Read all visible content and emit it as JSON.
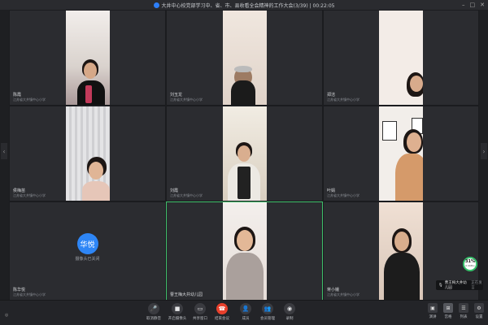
{
  "titlebar": {
    "title": "大井中心校党部学习中、省、市、县收看全会精神的工作大会(3/39) | 00:22:05"
  },
  "tiles": [
    {
      "name": "陈霞",
      "sub": "江苏省大井镇中心小学"
    },
    {
      "name": "刘玉龙",
      "sub": "江苏省大井镇中心小学"
    },
    {
      "name": "郑洁",
      "sub": "江苏省大井镇中心小学"
    },
    {
      "name": "侯梅苗",
      "sub": "江苏省大井镇中心小学"
    },
    {
      "name": "刘霞",
      "sub": "江苏省大井镇中心小学"
    },
    {
      "name": "叶娟",
      "sub": "江苏省大井镇中心小学"
    },
    {
      "name": "陈华悦",
      "sub": "江苏省大井镇中心小学",
      "avatar_text": "华悦",
      "avatar_caption": "摄像头已关闭"
    },
    {
      "name": "曹王梅大井幼儿园",
      "sub": ""
    },
    {
      "name": "蒋小娥",
      "sub": "江苏省大井镇中心小学"
    }
  ],
  "toolbar": {
    "buttons": [
      {
        "label": "取消静音",
        "icon": "mic-icon"
      },
      {
        "label": "开启摄像头",
        "icon": "camera-icon"
      },
      {
        "label": "共享窗口",
        "icon": "share-icon"
      },
      {
        "label": "结束会议",
        "icon": "end-call-icon"
      },
      {
        "label": "成员",
        "icon": "members-icon"
      },
      {
        "label": "会员管理",
        "icon": "manage-icon"
      },
      {
        "label": "录制",
        "icon": "record-icon"
      }
    ],
    "views": [
      {
        "label": "演讲"
      },
      {
        "label": "宫格"
      },
      {
        "label": "列表"
      },
      {
        "label": "设置"
      }
    ]
  },
  "network": {
    "percent": "31%",
    "speed": "0.9KB/s"
  },
  "speaking": {
    "name": "曹王梅大井幼儿园",
    "tag": "正在发言"
  },
  "colors": {
    "active_border": "#3fbf6a",
    "end_call": "#e8402c",
    "avatar": "#2e86f6"
  }
}
